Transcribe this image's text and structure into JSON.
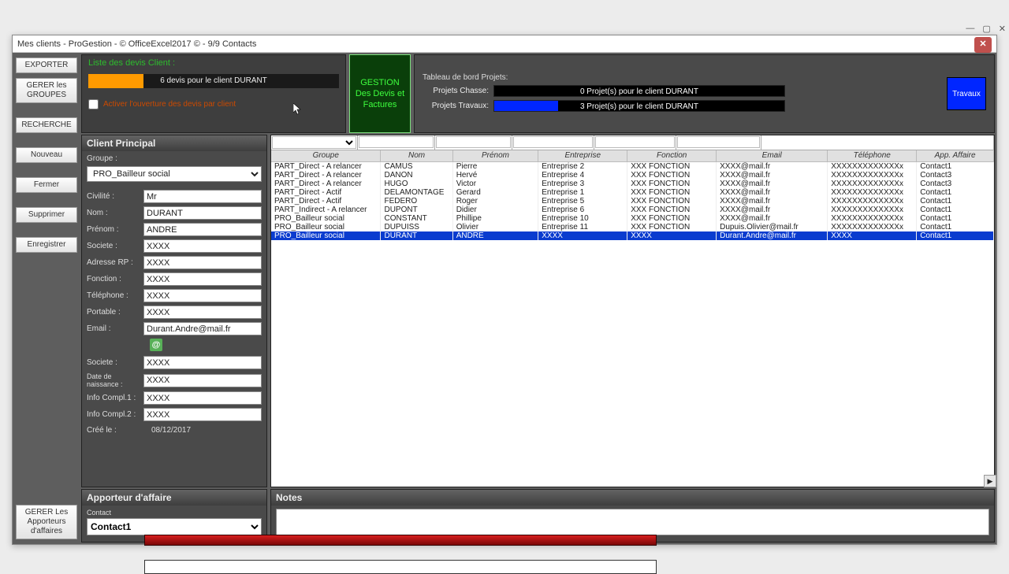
{
  "window": {
    "title": "Mes clients - ProGestion - © OfficeExcel2017 © - 9/9 Contacts"
  },
  "sidebar": {
    "exporter": "EXPORTER",
    "gerer_groupes": "GERER les\nGROUPES",
    "recherche": "RECHERCHE",
    "nouveau": "Nouveau",
    "fermer": "Fermer",
    "supprimer": "Supprimer",
    "enregistrer": "Enregistrer",
    "gerer_apporteurs": "GERER Les\nApporteurs\nd'affaires"
  },
  "devis": {
    "title": "Liste des devis Client :",
    "bar_text": "6 devis pour le client DURANT",
    "checkbox_label": "Activer l'ouverture des devis par client"
  },
  "gestion_btn": "GESTION\nDes Devis et\nFactures",
  "dashboard": {
    "title": "Tableau de bord Projets:",
    "chasse_label": "Projets Chasse:",
    "chasse_text": "0 Projet(s) pour le client DURANT",
    "travaux_label": "Projets Travaux:",
    "travaux_text": "3 Projet(s) pour le client DURANT",
    "travaux_btn": "Travaux"
  },
  "client": {
    "panel_title": "Client Principal",
    "groupe_label": "Groupe :",
    "groupe_value": "PRO_Bailleur social",
    "civilite_label": "Civilité :",
    "civilite_value": "Mr",
    "nom_label": "Nom :",
    "nom_value": "DURANT",
    "prenom_label": "Prénom :",
    "prenom_value": "ANDRE",
    "societe_label": "Societe :",
    "societe_value": "XXXX",
    "adresse_label": "Adresse RP :",
    "adresse_value": "XXXX",
    "fonction_label": "Fonction :",
    "fonction_value": "XXXX",
    "telephone_label": "Téléphone :",
    "telephone_value": "XXXX",
    "portable_label": "Portable :",
    "portable_value": "XXXX",
    "email_label": "Email :",
    "email_value": "Durant.Andre@mail.fr",
    "societe2_label": "Societe :",
    "societe2_value": "XXXX",
    "naissance_label": "Date de naissance :",
    "naissance_value": "XXXX",
    "info1_label": "Info Compl.1 :",
    "info1_value": "XXXX",
    "info2_label": "Info Compl.2 :",
    "info2_value": "XXXX",
    "cree_label": "Créé le :",
    "cree_value": "08/12/2017"
  },
  "grid": {
    "headers": [
      "Groupe",
      "Nom",
      "Prénom",
      "Entreprise",
      "Fonction",
      "Email",
      "Téléphone",
      "App. Affaire"
    ],
    "rows": [
      {
        "g": "PART_Direct - A relancer",
        "n": "CAMUS",
        "p": "Pierre",
        "e": "Entreprise 2",
        "f": "XXX FONCTION",
        "m": "XXXX@mail.fr",
        "t": "XXXXXXXXXXXXXx",
        "a": "Contact1"
      },
      {
        "g": "PART_Direct - A relancer",
        "n": "DANON",
        "p": "Hervé",
        "e": "Entreprise 4",
        "f": "XXX FONCTION",
        "m": "XXXX@mail.fr",
        "t": "XXXXXXXXXXXXXx",
        "a": "Contact3"
      },
      {
        "g": "PART_Direct - A relancer",
        "n": "HUGO",
        "p": "Victor",
        "e": "Entreprise 3",
        "f": "XXX FONCTION",
        "m": "XXXX@mail.fr",
        "t": "XXXXXXXXXXXXXx",
        "a": "Contact3"
      },
      {
        "g": "PART_Direct - Actif",
        "n": "DELAMONTAGE",
        "p": "Gerard",
        "e": "Entreprise 1",
        "f": "XXX FONCTION",
        "m": "XXXX@mail.fr",
        "t": "XXXXXXXXXXXXXx",
        "a": "Contact1"
      },
      {
        "g": "PART_Direct - Actif",
        "n": "FEDERO",
        "p": "Roger",
        "e": "Entreprise 5",
        "f": "XXX FONCTION",
        "m": "XXXX@mail.fr",
        "t": "XXXXXXXXXXXXXx",
        "a": "Contact1"
      },
      {
        "g": "PART_Indirect - A relancer",
        "n": "DUPONT",
        "p": "Didier",
        "e": "Entreprise 6",
        "f": "XXX FONCTION",
        "m": "XXXX@mail.fr",
        "t": "XXXXXXXXXXXXXx",
        "a": "Contact1"
      },
      {
        "g": "PRO_Bailleur social",
        "n": "CONSTANT",
        "p": "Phillipe",
        "e": "Entreprise 10",
        "f": "XXX FONCTION",
        "m": "XXXX@mail.fr",
        "t": "XXXXXXXXXXXXXx",
        "a": "Contact1"
      },
      {
        "g": "PRO_Bailleur social",
        "n": "DUPUISS",
        "p": "Olivier",
        "e": "Entreprise 11",
        "f": "XXX FONCTION",
        "m": "Dupuis.Olivier@mail.fr",
        "t": "XXXXXXXXXXXXXx",
        "a": "Contact1"
      },
      {
        "g": "PRO_Bailleur social",
        "n": "DURANT",
        "p": "ANDRE",
        "e": "XXXX",
        "f": "XXXX",
        "m": "Durant.Andre@mail.fr",
        "t": "XXXX",
        "a": "Contact1"
      }
    ],
    "selected_index": 8
  },
  "apporteur": {
    "panel_title": "Apporteur d'affaire",
    "contact_label": "Contact",
    "contact_value": "Contact1"
  },
  "notes": {
    "panel_title": "Notes",
    "value": ""
  }
}
